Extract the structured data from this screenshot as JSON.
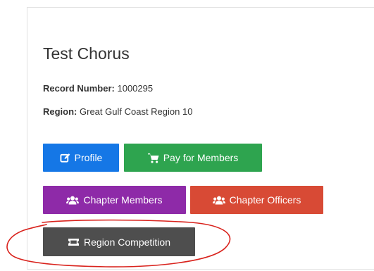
{
  "chorus": {
    "name": "Test Chorus",
    "record_label": "Record Number:",
    "record_value": "1000295",
    "region_label": "Region:",
    "region_value": "Great Gulf Coast Region 10"
  },
  "buttons": {
    "profile": "Profile",
    "pay_for_members": "Pay for Members",
    "chapter_members": "Chapter Members",
    "chapter_officers": "Chapter Officers",
    "region_competition": "Region Competition"
  },
  "icons": {
    "profile": "edit-icon",
    "pay_for_members": "cart-icon",
    "chapter_members": "users-icon",
    "chapter_officers": "users-icon",
    "region_competition": "ticket-icon"
  },
  "colors": {
    "profile": "#1577e6",
    "pay_for_members": "#2ea44f",
    "chapter_members": "#8e2aa8",
    "chapter_officers": "#d84a35",
    "region_competition": "#4e4e4e",
    "annotation": "#d9231d"
  }
}
